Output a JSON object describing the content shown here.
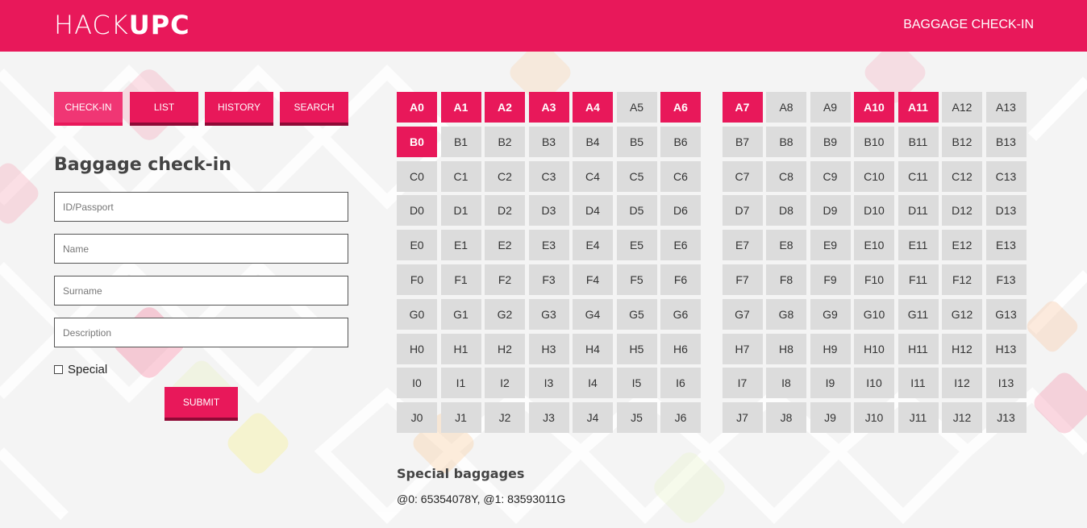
{
  "header": {
    "logo_light": "HACK",
    "logo_bold": "UPC",
    "link_label": "BAGGAGE CHECK-IN"
  },
  "tabs": [
    {
      "label": "CHECK-IN",
      "active": true
    },
    {
      "label": "LIST",
      "active": false
    },
    {
      "label": "HISTORY",
      "active": false
    },
    {
      "label": "SEARCH",
      "active": false
    }
  ],
  "form": {
    "title": "Baggage check-in",
    "fields": [
      {
        "placeholder": "ID/Passport",
        "value": ""
      },
      {
        "placeholder": "Name",
        "value": ""
      },
      {
        "placeholder": "Surname",
        "value": ""
      },
      {
        "placeholder": "Description",
        "value": ""
      }
    ],
    "special_label": "Special",
    "special_checked": false,
    "submit_label": "SUBMIT"
  },
  "storage": {
    "rows": [
      "A",
      "B",
      "C",
      "D",
      "E",
      "F",
      "G",
      "H",
      "I",
      "J"
    ],
    "columns": [
      0,
      1,
      2,
      3,
      4,
      5,
      6,
      7,
      8,
      9,
      10,
      11,
      12,
      13
    ],
    "occupied": [
      "A0",
      "A1",
      "A2",
      "A3",
      "A4",
      "A6",
      "A7",
      "A10",
      "A11",
      "B0"
    ]
  },
  "special_baggages": {
    "title": "Special baggages",
    "text": "@0: 65354078Y, @1: 83593011G"
  },
  "colors": {
    "accent": "#e8185a",
    "accent_dark": "#8e0a36",
    "slot_free": "#dcdcdc"
  }
}
